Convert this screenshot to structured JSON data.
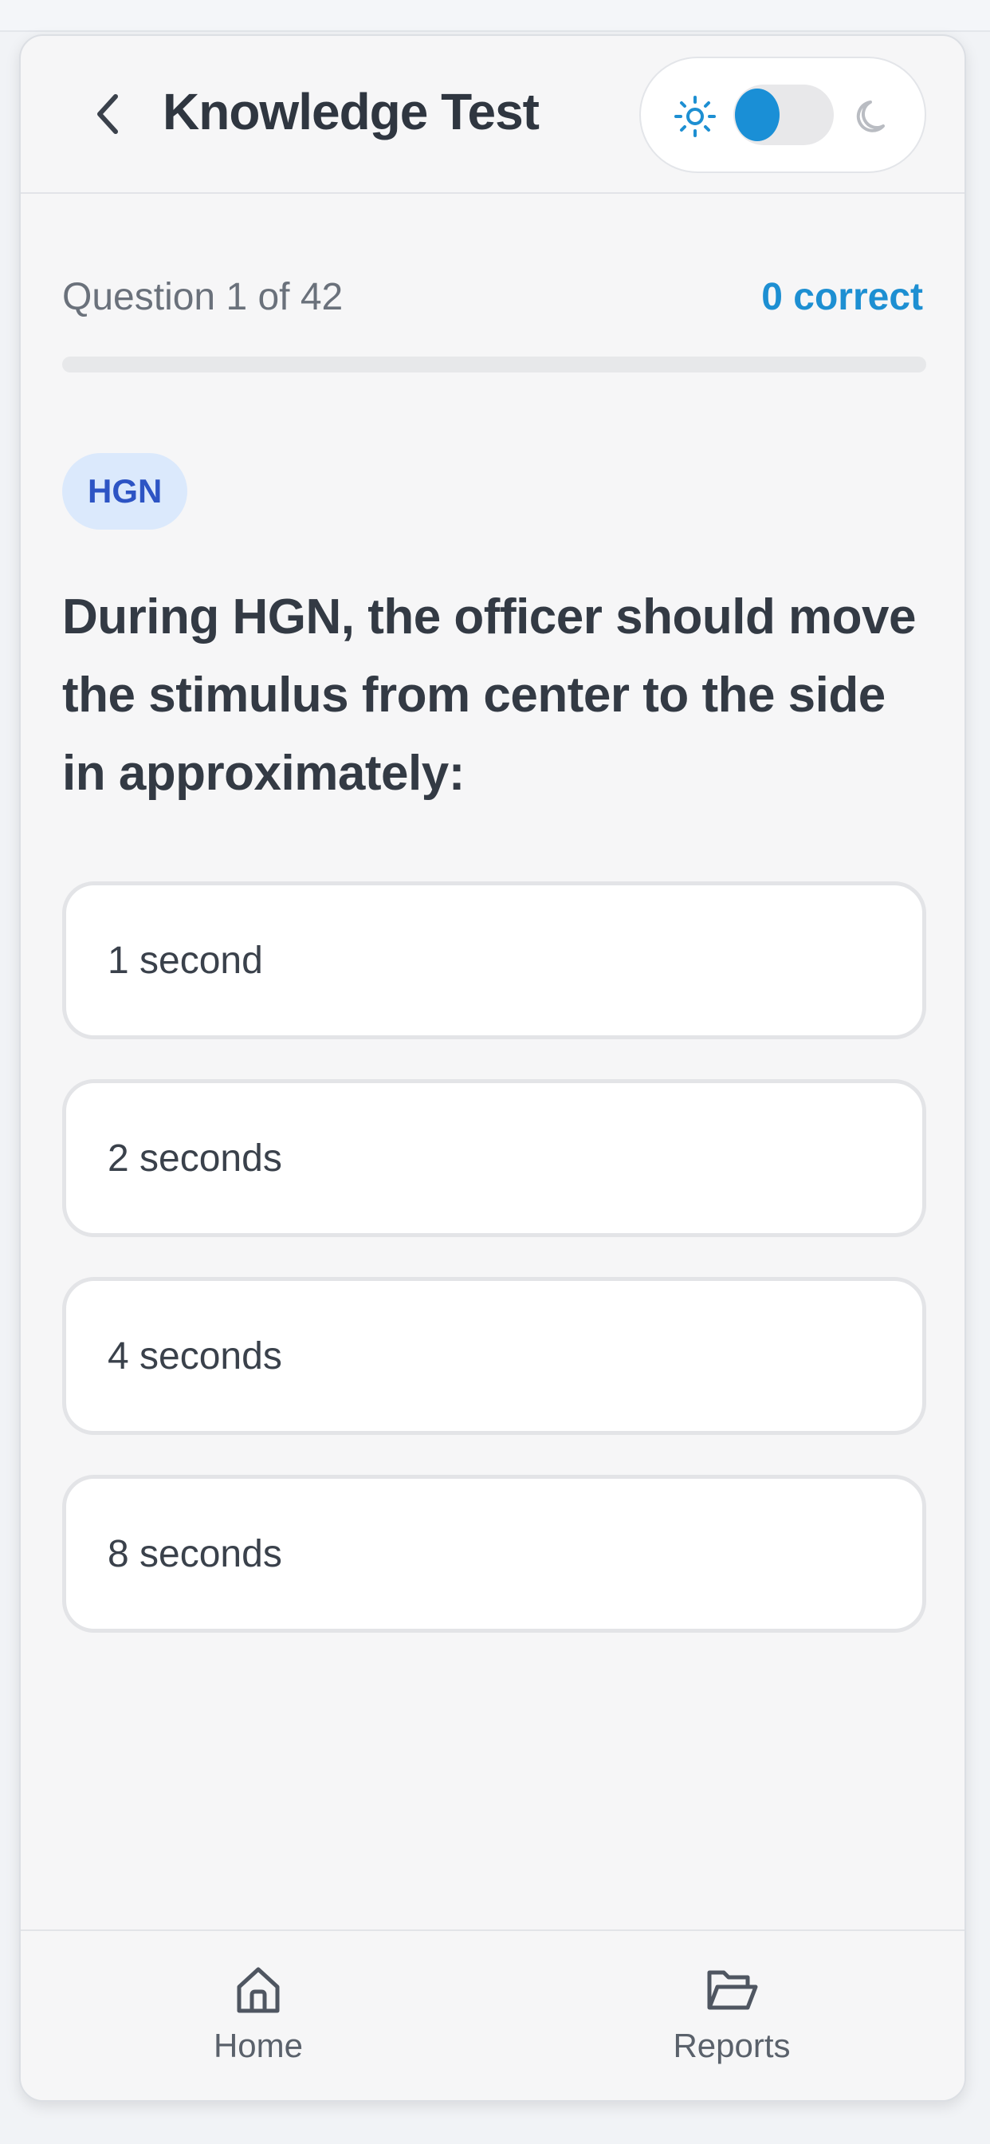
{
  "header": {
    "title": "Knowledge Test",
    "back_icon": "chevron-left-icon",
    "theme_toggle": {
      "mode": "light",
      "light_icon": "sun-icon",
      "dark_icon": "moon-icon"
    }
  },
  "progress": {
    "label": "Question 1 of 42",
    "correct_label": "0 correct",
    "current": 1,
    "total": 42,
    "fraction_complete": 0
  },
  "question": {
    "category": "HGN",
    "text": "During HGN, the officer should move the stimulus from center to the side in approximately:",
    "options": [
      {
        "label": "1 second"
      },
      {
        "label": "2 seconds"
      },
      {
        "label": "4 seconds"
      },
      {
        "label": "8 seconds"
      }
    ]
  },
  "nav": {
    "items": [
      {
        "label": "Home",
        "icon": "home-icon"
      },
      {
        "label": "Reports",
        "icon": "folder-open-icon"
      }
    ]
  },
  "colors": {
    "accent": "#1d8fd2",
    "badge_bg": "#dbe9fc",
    "badge_text": "#2d54c4",
    "title_text": "#2f3640"
  }
}
